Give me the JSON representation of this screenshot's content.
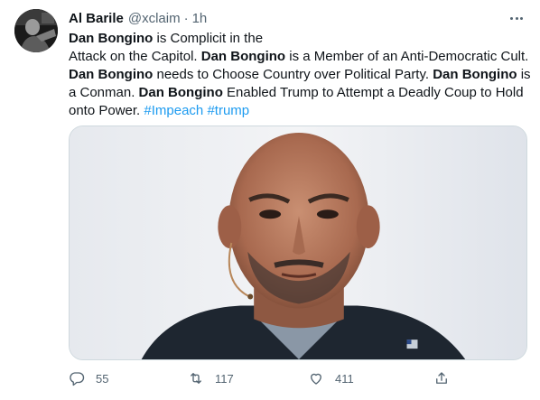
{
  "tweet": {
    "author_name": "Al Barile",
    "author_handle": "@xclaim",
    "separator": "·",
    "time": "1h",
    "lines": [
      [
        {
          "t": "Dan Bongino",
          "s": "b"
        },
        {
          "t": " is Complicit in the",
          "s": ""
        }
      ],
      [
        {
          "t": "Attack on the Capitol. ",
          "s": ""
        },
        {
          "t": "Dan Bongino",
          "s": "b"
        },
        {
          "t": " is a Member of an Anti-Democratic Cult.",
          "s": ""
        }
      ],
      [
        {
          "t": "Dan Bongino",
          "s": "b"
        },
        {
          "t": "  needs to Choose Country over Political Party. ",
          "s": ""
        },
        {
          "t": "Dan Bongino",
          "s": "b"
        },
        {
          "t": " is",
          "s": ""
        }
      ],
      [
        {
          "t": "a Conman. ",
          "s": ""
        },
        {
          "t": "Dan Bongino",
          "s": "b"
        },
        {
          "t": " Enabled Trump to Attempt a Deadly Coup to Hold",
          "s": ""
        }
      ],
      [
        {
          "t": "onto Power. ",
          "s": ""
        },
        {
          "t": "#Impeach",
          "s": "tag"
        },
        {
          "t": " ",
          "s": ""
        },
        {
          "t": "#trump",
          "s": "tag"
        }
      ]
    ]
  },
  "actions": {
    "reply_count": "55",
    "retweet_count": "117",
    "like_count": "411"
  },
  "icons": {
    "more": "more-horizontal-icon",
    "reply": "reply-icon",
    "retweet": "retweet-icon",
    "like": "heart-icon",
    "share": "share-icon"
  },
  "colors": {
    "text": "#0f1419",
    "secondary": "#536471",
    "link": "#1d9bf0",
    "border": "#cfd9de"
  }
}
